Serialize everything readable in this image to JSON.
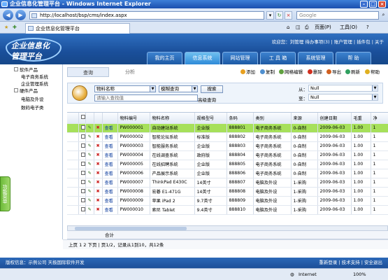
{
  "browser": {
    "window_title": "企业信息化管理平台 - Windows Internet Explorer",
    "address": "http://localhost/bsp/cms/index.aspx",
    "search_placeholder": "Google",
    "tab_title": "企业信息化管理平台",
    "toolbar_page": "页面(P)",
    "toolbar_tools": "工具(O)",
    "status_zone": "Internet",
    "zoom": "100%"
  },
  "header": {
    "logo_line1": "企业信息化",
    "logo_line2": "管理平台",
    "user_line": "欢迎您：刘管理  待办事项(3)  |  账户管理  |  插件包  |  关于",
    "nav": [
      "我的主页",
      "信息系统",
      "网站管理",
      "工 具 箱",
      "系统管理",
      "帮 助"
    ],
    "active_nav": 1
  },
  "sidebar": {
    "items": [
      {
        "label": "软件产品",
        "level": 0
      },
      {
        "label": "电子商务系统",
        "level": 1
      },
      {
        "label": "企业管理系统",
        "level": 1
      },
      {
        "label": "硬件产品",
        "level": 0
      },
      {
        "label": "电脑及外设",
        "level": 1
      },
      {
        "label": "数码电子类",
        "level": 1
      }
    ],
    "func_menu": "功能菜单"
  },
  "subtabs": [
    "查询",
    "分析"
  ],
  "toolbar": {
    "add": "添加",
    "copy": "复制",
    "edit": "网格编辑",
    "delete": "删除",
    "export": "导出",
    "refresh": "刷新",
    "help": "帮助"
  },
  "search": {
    "field": "物料名称",
    "mode": "模糊查询",
    "placeholder": "请输入查找值",
    "button": "搜索",
    "advanced": "高级查询",
    "from_label": "从：",
    "from_value": "Null",
    "to_label": "至：",
    "to_value": "Null"
  },
  "table": {
    "columns": [
      "物料编号",
      "物料名称",
      "规格型号",
      "条码",
      "类别",
      "来源",
      "创建日期",
      "毛重",
      "净"
    ],
    "view_label": "查看",
    "rows": [
      [
        "PW000001",
        "自动建站系统",
        "企业版",
        "888801",
        "电子商务系统",
        "0-自制",
        "2009-06-03",
        "1.00",
        "1"
      ],
      [
        "PW000002",
        "智能论坛系统",
        "标准版",
        "888802",
        "电子商务系统",
        "0-自制",
        "2009-06-03",
        "1.00",
        "1"
      ],
      [
        "PW000003",
        "智能服务系统",
        "企业版",
        "888803",
        "电子商务系统",
        "0-自制",
        "2009-06-03",
        "1.00",
        "1"
      ],
      [
        "PW000004",
        "在线调查系统",
        "政府版",
        "888804",
        "电子商务系统",
        "0-自制",
        "2009-06-03",
        "1.00",
        "1"
      ],
      [
        "PW000005",
        "在线招聘系统",
        "企业版",
        "888805",
        "电子商务系统",
        "0-自制",
        "2009-06-03",
        "1.00",
        "1"
      ],
      [
        "PW000006",
        "产品展示系统",
        "企业版",
        "888806",
        "电子商务系统",
        "0-自制",
        "2009-06-03",
        "1.00",
        "1"
      ],
      [
        "PW000007",
        "ThinkPad E430C",
        "14英寸",
        "888807",
        "电脑及外设",
        "1-采购",
        "2009-06-03",
        "1.00",
        "1"
      ],
      [
        "PW000008",
        "宏碁 E1-471G",
        "14英寸",
        "888808",
        "电脑及外设",
        "1-采购",
        "2009-06-03",
        "1.00",
        "1"
      ],
      [
        "PW000009",
        "苹果 iPad 2",
        "9.7英寸",
        "888809",
        "电脑及外设",
        "1-采购",
        "2009-06-03",
        "1.00",
        "1"
      ],
      [
        "PW000010",
        "索尼 Tablet",
        "9.4英寸",
        "888810",
        "电脑及外设",
        "1-采购",
        "2009-06-03",
        "1.00",
        "1"
      ]
    ],
    "total_label": "合计"
  },
  "pager": "上页  1 2 下页  |  页1/2，记录从1到10，共12条",
  "footer": {
    "left": "版权信息：示例公司   天极国际软件开发",
    "right": "重新登录  |  技术支持  |  安全退出"
  }
}
